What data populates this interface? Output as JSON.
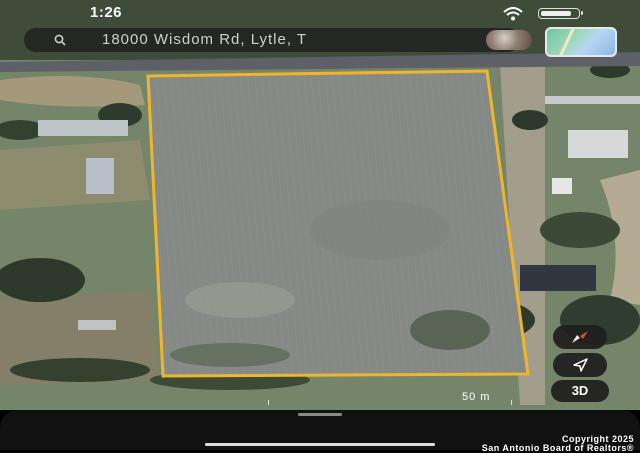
{
  "status_bar": {
    "time": "1:26",
    "battery_level": 0.85
  },
  "search": {
    "query": "18000 Wisdom Rd, Lytle, T"
  },
  "map": {
    "scale_label": "50 m",
    "button_3d": "3D",
    "boundary_color": "#f0b62b"
  },
  "footer": {
    "copyright_line1": "Copyright 2025",
    "copyright_line2": "San Antonio Board of Realtors®"
  }
}
